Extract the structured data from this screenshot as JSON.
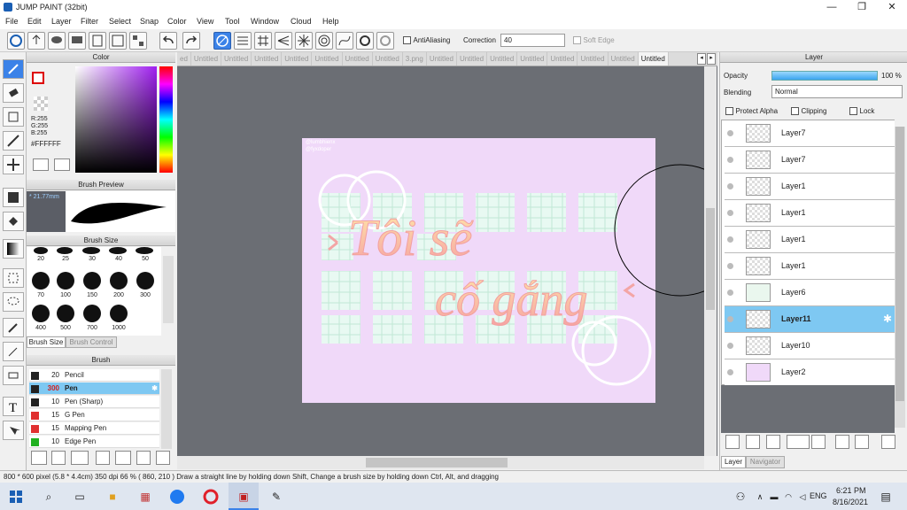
{
  "window": {
    "title": "JUMP PAINT (32bit)",
    "minimize": "—",
    "maximize": "❐",
    "close": "✕"
  },
  "menu": [
    "File",
    "Edit",
    "Layer",
    "Filter",
    "Select",
    "Snap",
    "Color",
    "View",
    "Tool",
    "Window",
    "Cloud",
    "Help"
  ],
  "toolbar": {
    "antialias_label": "AntiAliasing",
    "correction_label": "Correction",
    "correction_value": "40",
    "softedge_label": "Soft Edge"
  },
  "color_panel": {
    "title": "Color",
    "r": "R:255",
    "g": "G:255",
    "b": "B:255",
    "hex": "#FFFFFF",
    "accent": "#3b82e8"
  },
  "brush_preview": {
    "title": "Brush Preview",
    "size": "* 21.77mm"
  },
  "brush_size": {
    "title": "Brush Size",
    "sizes": [
      "20",
      "25",
      "30",
      "40",
      "50",
      "70",
      "100",
      "150",
      "200",
      "300",
      "400",
      "500",
      "700",
      "1000"
    ],
    "tab_size": "Brush Size",
    "tab_control": "Brush Control"
  },
  "brush": {
    "title": "Brush",
    "items": [
      {
        "size": "20",
        "name": "Pencil",
        "color": "#222222"
      },
      {
        "size": "300",
        "name": "Pen",
        "color": "#222222"
      },
      {
        "size": "10",
        "name": "Pen (Sharp)",
        "color": "#222222"
      },
      {
        "size": "15",
        "name": "G Pen",
        "color": "#e03030"
      },
      {
        "size": "15",
        "name": "Mapping Pen",
        "color": "#e03030"
      },
      {
        "size": "10",
        "name": "Edge Pen",
        "color": "#20b020"
      }
    ]
  },
  "tabs": [
    "ed",
    "Untitled",
    "Untitled",
    "Untitled",
    "Untitled",
    "Untitled",
    "Untitled",
    "Untitled",
    "3.png",
    "Untitled",
    "Untitled",
    "Untitled",
    "Untitled",
    "Untitled",
    "Untitled",
    "Untitled",
    "Untitled"
  ],
  "canvas": {
    "watermark1": "@lumbhienx",
    "watermark2": "@fyxdoper",
    "text1": "Tôi sẽ",
    "text2": "cố gắng"
  },
  "layer_panel": {
    "title": "Layer",
    "opacity_label": "Opacity",
    "opacity_value": "100 %",
    "blending_label": "Blending",
    "blending_value": "Normal",
    "protect_alpha": "Protect Alpha",
    "clipping": "Clipping",
    "lock": "Lock",
    "layers": [
      "Layer7",
      "Layer7",
      "Layer1",
      "Layer1",
      "Layer1",
      "Layer1",
      "Layer6",
      "Layer11",
      "Layer10",
      "Layer2"
    ],
    "tab_layer": "Layer",
    "tab_navigator": "Navigator"
  },
  "status": "800 * 600 pixel   (5.8 * 4.4cm)  350 dpi   66 %   ( 860, 210 )   Draw a straight line by holding down Shift, Change a brush size by holding down Ctrl, Alt, and dragging",
  "taskbar": {
    "lang": "ENG",
    "time": "6:21 PM",
    "date": "8/16/2021"
  }
}
